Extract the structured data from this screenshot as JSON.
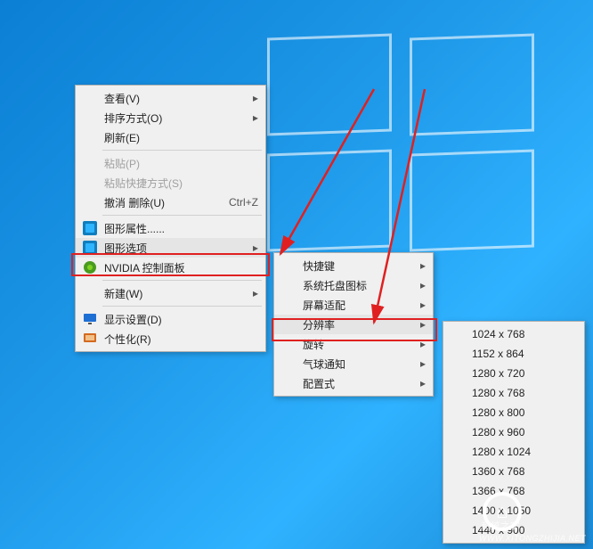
{
  "menu1": {
    "items": [
      {
        "label": "查看(V)",
        "name": "view",
        "arrow": true
      },
      {
        "label": "排序方式(O)",
        "name": "sort-by",
        "arrow": true
      },
      {
        "label": "刷新(E)",
        "name": "refresh"
      },
      {
        "sep": true
      },
      {
        "label": "粘贴(P)",
        "name": "paste",
        "disabled": true
      },
      {
        "label": "粘贴快捷方式(S)",
        "name": "paste-shortcut",
        "disabled": true
      },
      {
        "label": "撤消 删除(U)",
        "name": "undo-delete",
        "shortcut": "Ctrl+Z"
      },
      {
        "sep": true
      },
      {
        "label": "图形属性......",
        "name": "graphics-properties",
        "icon": "intel-blue"
      },
      {
        "label": "图形选项",
        "name": "graphics-options",
        "icon": "intel-blue",
        "arrow": true,
        "highlight": true,
        "hover": true
      },
      {
        "label": "NVIDIA 控制面板",
        "name": "nvidia-control-panel",
        "icon": "nvidia-green"
      },
      {
        "sep": true
      },
      {
        "label": "新建(W)",
        "name": "new",
        "arrow": true
      },
      {
        "sep": true
      },
      {
        "label": "显示设置(D)",
        "name": "display-settings",
        "icon": "monitor"
      },
      {
        "label": "个性化(R)",
        "name": "personalize",
        "icon": "personalize"
      }
    ]
  },
  "menu2": {
    "items": [
      {
        "label": "快捷键",
        "name": "hotkeys",
        "arrow": true
      },
      {
        "label": "系统托盘图标",
        "name": "tray-icon",
        "arrow": true
      },
      {
        "label": "屏幕适配",
        "name": "screen-fit",
        "arrow": true
      },
      {
        "label": "分辨率",
        "name": "resolution",
        "arrow": true,
        "highlight": true,
        "hover": true
      },
      {
        "label": "旋转",
        "name": "rotation",
        "arrow": true
      },
      {
        "label": "气球通知",
        "name": "balloon-notify",
        "arrow": true
      },
      {
        "label": "配置式",
        "name": "profile",
        "arrow": true
      }
    ]
  },
  "menu3": {
    "items": [
      {
        "label": "1024 x 768",
        "name": "res-1024x768"
      },
      {
        "label": "1152 x 864",
        "name": "res-1152x864"
      },
      {
        "label": "1280 x 720",
        "name": "res-1280x720"
      },
      {
        "label": "1280 x 768",
        "name": "res-1280x768"
      },
      {
        "label": "1280 x 800",
        "name": "res-1280x800"
      },
      {
        "label": "1280 x 960",
        "name": "res-1280x960"
      },
      {
        "label": "1280 x 1024",
        "name": "res-1280x1024"
      },
      {
        "label": "1360 x 768",
        "name": "res-1360x768"
      },
      {
        "label": "1366 x 768",
        "name": "res-1366x768"
      },
      {
        "label": "1400 x 1050",
        "name": "res-1400x1050"
      },
      {
        "label": "1440 x 900",
        "name": "res-1440x900"
      }
    ]
  },
  "watermark": "系统之家",
  "watermark_sub": "WWW.XITONGZHIJIA.NET"
}
